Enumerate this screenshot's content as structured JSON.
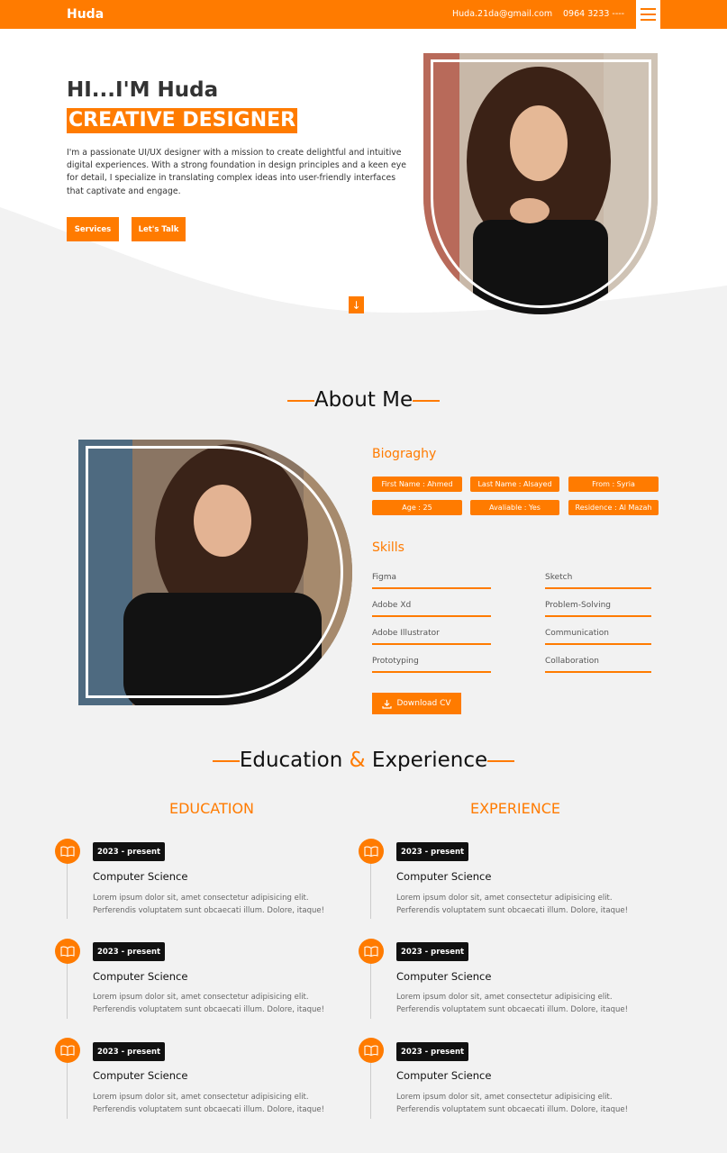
{
  "nav": {
    "logo": "Huda",
    "email": "Huda.21da@gmail.com",
    "phone": "0964 3233 ----",
    "menu_icon": "hamburger-icon"
  },
  "hero": {
    "greeting": "HI...I'M Huda",
    "role": "CREATIVE DESIGNER",
    "description": "I'm a passionate UI/UX designer with a mission to create delightful and intuitive digital experiences. With a strong foundation in design principles and a keen eye for detail, I specialize in translating complex ideas into user-friendly interfaces that captivate and engage.",
    "btn_services": "Services",
    "btn_talk": "Let's Talk",
    "scroll_icon": "arrow-down-icon"
  },
  "about": {
    "title": "About Me",
    "bio_title": "Biograghy",
    "bio": [
      "First Name : Ahmed",
      "Last Name : Alsayed",
      "From : Syria",
      "Age : 25",
      "Avaliable : Yes",
      "Residence : Al Mazah"
    ],
    "skills_title": "Skills",
    "skills": [
      "Figma",
      "Sketch",
      "Adobe Xd",
      "Problem-Solving",
      "Adobe Illustrator",
      "Communication",
      "Prototyping",
      "Collaboration"
    ],
    "download": "Download CV"
  },
  "edu_exp": {
    "title_a": "Education",
    "title_amp": "&",
    "title_b": "Experience",
    "education_title": "EDUCATION",
    "experience_title": "EXPERIENCE",
    "education": [
      {
        "date": "2023 - present",
        "title": "Computer Science",
        "text1": "Lorem ipsum dolor sit, amet consectetur adipisicing elit.",
        "text2": "Perferendis voluptatem sunt obcaecati illum. Dolore, itaque!"
      },
      {
        "date": "2023 - present",
        "title": "Computer Science",
        "text1": "Lorem ipsum dolor sit, amet consectetur adipisicing elit.",
        "text2": "Perferendis voluptatem sunt obcaecati illum. Dolore, itaque!"
      },
      {
        "date": "2023 - present",
        "title": "Computer Science",
        "text1": "Lorem ipsum dolor sit, amet consectetur adipisicing elit.",
        "text2": "Perferendis voluptatem sunt obcaecati illum. Dolore, itaque!"
      }
    ],
    "experience": [
      {
        "date": "2023 - present",
        "title": "Computer Science",
        "text1": "Lorem ipsum dolor sit, amet consectetur adipisicing elit.",
        "text2": "Perferendis voluptatem sunt obcaecati illum. Dolore, itaque!"
      },
      {
        "date": "2023 - present",
        "title": "Computer Science",
        "text1": "Lorem ipsum dolor sit, amet consectetur adipisicing elit.",
        "text2": "Perferendis voluptatem sunt obcaecati illum. Dolore, itaque!"
      },
      {
        "date": "2023 - present",
        "title": "Computer Science",
        "text1": "Lorem ipsum dolor sit, amet consectetur adipisicing elit.",
        "text2": "Perferendis voluptatem sunt obcaecati illum. Dolore, itaque!"
      }
    ]
  },
  "colors": {
    "accent": "#ff7b00",
    "background": "#f2f2f2",
    "dark": "#111111"
  }
}
